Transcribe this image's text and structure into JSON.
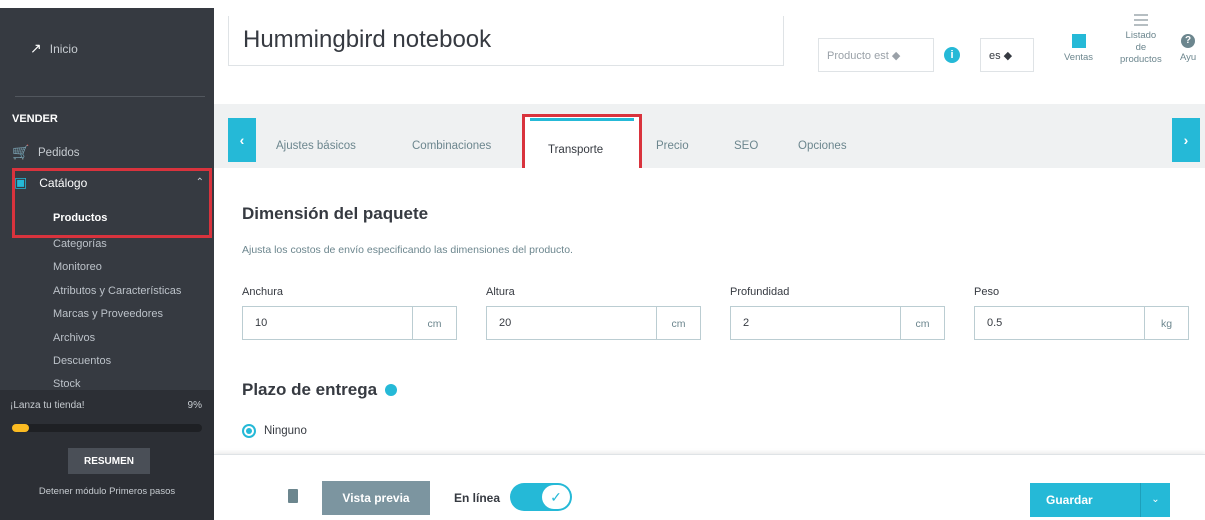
{
  "sidebar": {
    "home_icon": "trend-icon",
    "home_label": "Inicio",
    "section_label": "VENDER",
    "orders_label": "Pedidos",
    "catalog_label": "Catálogo",
    "catalog_items": [
      "Productos",
      "Categorías",
      "Monitoreo",
      "Atributos y Características",
      "Marcas y Proveedores",
      "Archivos",
      "Descuentos",
      "Stock"
    ],
    "launch_label": "¡Lanza tu tienda!",
    "launch_percent": "9%",
    "launch_progress": 0.09,
    "resumen_label": "RESUMEN",
    "stop_label": "Detener módulo Primeros pasos"
  },
  "header": {
    "product_name": "Hummingbird notebook",
    "product_type": "Producto est ◆",
    "lang": "es ◆",
    "sales_label": "Ventas",
    "list_label_1": "Listado",
    "list_label_2": "de",
    "list_label_3": "productos",
    "help_label": "Ayu"
  },
  "tabs": {
    "left_arrow": "‹",
    "right_arrow": "›",
    "basic": "Ajustes básicos",
    "combinations": "Combinaciones",
    "shipping": "Transporte",
    "price": "Precio",
    "seo": "SEO",
    "options": "Opciones"
  },
  "package": {
    "title": "Dimensión del paquete",
    "description": "Ajusta los costos de envío especificando las dimensiones del producto.",
    "fields": [
      {
        "label": "Anchura",
        "value": "10",
        "unit": "cm"
      },
      {
        "label": "Altura",
        "value": "20",
        "unit": "cm"
      },
      {
        "label": "Profundidad",
        "value": "2",
        "unit": "cm"
      },
      {
        "label": "Peso",
        "value": "0.5",
        "unit": "kg"
      }
    ]
  },
  "delivery": {
    "title": "Plazo de entrega",
    "option": "Ninguno"
  },
  "footer": {
    "preview_label": "Vista previa",
    "online_label": "En línea",
    "save_label": "Guardar"
  },
  "colors": {
    "accent": "#25b9d7",
    "highlight": "#d9333d",
    "sidebar": "#363a41"
  }
}
